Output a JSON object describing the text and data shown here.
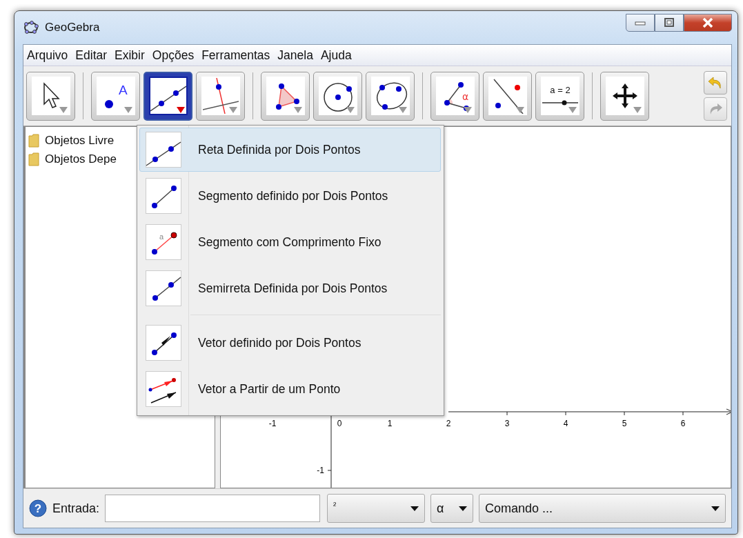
{
  "window": {
    "title": "GeoGebra"
  },
  "menu_bar": [
    "Arquivo",
    "Editar",
    "Exibir",
    "Opções",
    "Ferramentas",
    "Janela",
    "Ajuda"
  ],
  "tool_groups": [
    [
      {
        "kind": "move",
        "selected": false
      }
    ],
    [
      {
        "kind": "point",
        "label": "A",
        "selected": false
      },
      {
        "kind": "line",
        "selected": true
      },
      {
        "kind": "perpendicular",
        "selected": false
      }
    ],
    [
      {
        "kind": "polygon",
        "selected": false
      },
      {
        "kind": "circle",
        "selected": false
      },
      {
        "kind": "conic",
        "selected": false
      }
    ],
    [
      {
        "kind": "angle",
        "label": "α",
        "selected": false
      },
      {
        "kind": "reflect",
        "selected": false
      },
      {
        "kind": "slider",
        "label": "a = 2",
        "selected": false
      }
    ],
    [
      {
        "kind": "move-view",
        "selected": false
      }
    ]
  ],
  "history": [
    {
      "kind": "undo",
      "disabled": false
    },
    {
      "kind": "redo",
      "disabled": true
    }
  ],
  "algebra": [
    "Objetos Livre",
    "Objetos Depe"
  ],
  "tool_menu_groups": [
    [
      {
        "kind": "line",
        "label": "Reta Definida por Dois Pontos",
        "selected": true
      },
      {
        "kind": "segment",
        "label": "Segmento definido por Dois Pontos",
        "selected": false
      },
      {
        "kind": "segment-fixed",
        "label": "Segmento com Comprimento Fixo",
        "icon_label": "a",
        "selected": false
      },
      {
        "kind": "ray",
        "label": "Semirreta Definida por Dois Pontos",
        "selected": false
      }
    ],
    [
      {
        "kind": "vector",
        "label": "Vetor definido por Dois Pontos",
        "selected": false
      },
      {
        "kind": "vector-from-point",
        "label": "Vetor a Partir de um Ponto",
        "selected": false
      }
    ]
  ],
  "graphics": {
    "x_labels": [
      "-1",
      "0",
      "1",
      "2",
      "3",
      "4",
      "5",
      "6"
    ],
    "y_labels": [
      "-1"
    ]
  },
  "input_bar": {
    "help": "?",
    "label": "Entrada:",
    "symbols": "²",
    "greek": "α",
    "command": "Comando ..."
  }
}
